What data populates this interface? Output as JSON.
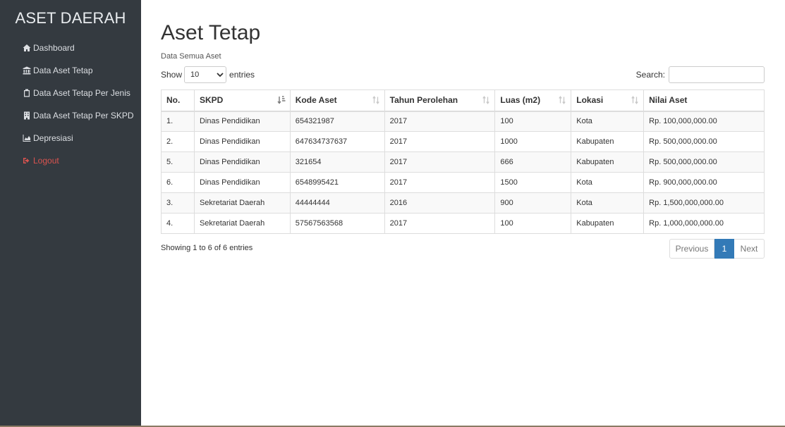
{
  "sidebar": {
    "brand": "ASET DAERAH",
    "items": [
      {
        "label": "Dashboard",
        "icon": "home-icon"
      },
      {
        "label": "Data Aset Tetap",
        "icon": "bank-icon"
      },
      {
        "label": "Data Aset Tetap Per Jenis",
        "icon": "clipboard-icon"
      },
      {
        "label": "Data Aset Tetap Per SKPD",
        "icon": "building-icon"
      },
      {
        "label": "Depresiasi",
        "icon": "area-chart-icon"
      },
      {
        "label": "Logout",
        "icon": "sign-out-icon",
        "color": "#d9534f"
      }
    ]
  },
  "page": {
    "title": "Aset Tetap",
    "subtitle": "Data Semua Aset"
  },
  "controls": {
    "show_label": "Show",
    "entries_value": "10",
    "entries_label": "entries",
    "search_label": "Search:",
    "search_value": ""
  },
  "table": {
    "columns": [
      "No.",
      "SKPD",
      "Kode Aset",
      "Tahun Perolehan",
      "Luas (m2)",
      "Lokasi",
      "Nilai Aset"
    ],
    "rows": [
      [
        "1.",
        "Dinas Pendidikan",
        "654321987",
        "2017",
        "100",
        "Kota",
        "Rp. 100,000,000.00"
      ],
      [
        "2.",
        "Dinas Pendidikan",
        "647634737637",
        "2017",
        "1000",
        "Kabupaten",
        "Rp. 500,000,000.00"
      ],
      [
        "5.",
        "Dinas Pendidikan",
        "321654",
        "2017",
        "666",
        "Kabupaten",
        "Rp. 500,000,000.00"
      ],
      [
        "6.",
        "Dinas Pendidikan",
        "6548995421",
        "2017",
        "1500",
        "Kota",
        "Rp. 900,000,000.00"
      ],
      [
        "3.",
        "Sekretariat Daerah",
        "44444444",
        "2016",
        "900",
        "Kota",
        "Rp. 1,500,000,000.00"
      ],
      [
        "4.",
        "Sekretariat Daerah",
        "57567563568",
        "2017",
        "100",
        "Kabupaten",
        "Rp. 1,000,000,000.00"
      ]
    ]
  },
  "footer": {
    "info": "Showing 1 to 6 of 6 entries",
    "prev_label": "Previous",
    "current_page": "1",
    "next_label": "Next"
  },
  "colors": {
    "sidebar_bg": "#343a40",
    "accent": "#337ab7",
    "logout": "#d9534f"
  }
}
